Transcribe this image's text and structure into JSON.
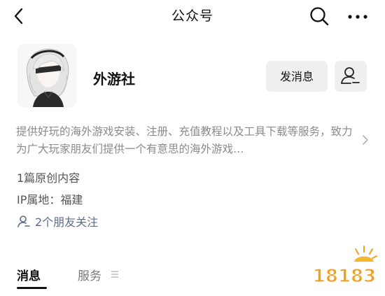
{
  "nav": {
    "title": "公众号"
  },
  "profile": {
    "name": "外游社",
    "message_button_label": "发消息",
    "description": "提供好玩的海外游戏安装、注册、充值教程以及工具下载等服务，致力为广大玩家朋友们提供一个有意思的海外游戏…",
    "original_count_text": "1篇原创内容",
    "ip_location_text": "IP属地：福建",
    "friends_following_text": "2个朋友关注"
  },
  "tabs": [
    {
      "label": "消息",
      "selected": true
    },
    {
      "label": "服务",
      "selected": false
    }
  ],
  "watermark": {
    "text": "18183"
  },
  "icons": {
    "back": "back-arrow-icon",
    "search": "search-icon",
    "more": "more-dots-icon",
    "follow": "person-follow-icon",
    "friends": "person-icon",
    "chevron": "chevron-right-icon",
    "service_menu": "menu-lines-icon"
  },
  "colors": {
    "button_bg": "#efefef",
    "description": "#8a8a8a",
    "friends_link": "#5c6b8a",
    "watermark": "#f0a020"
  }
}
